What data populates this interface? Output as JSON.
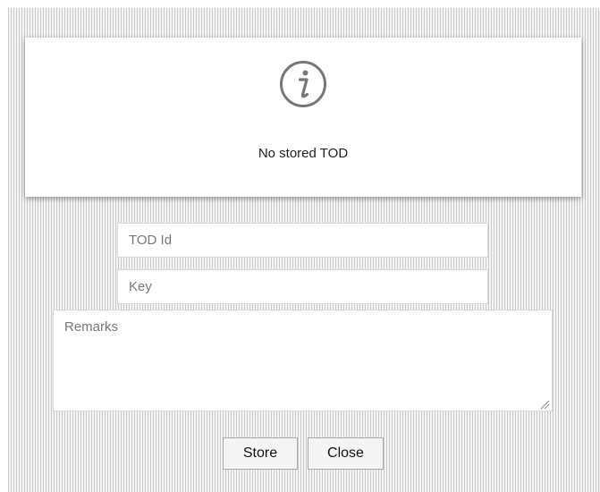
{
  "dialog": {
    "icon": "info-circle-icon",
    "message": "No stored TOD"
  },
  "form": {
    "tod_id_placeholder": "TOD Id",
    "key_placeholder": "Key",
    "remarks_placeholder": "Remarks"
  },
  "buttons": {
    "store_label": "Store",
    "close_label": "Close"
  },
  "colors": {
    "card_background": "#ffffff",
    "icon_color": "#777777",
    "backdrop_stripe": "#c9c9c9"
  }
}
